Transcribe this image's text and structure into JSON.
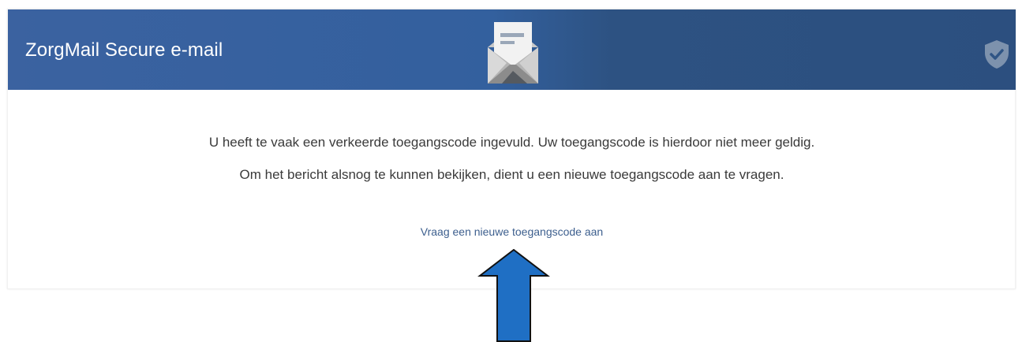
{
  "header": {
    "title": "ZorgMail Secure e-mail",
    "envelope_icon": "envelope-open-icon",
    "shield_icon": "shield-check-icon",
    "gradient_start": "#3b62a0",
    "gradient_end": "#2c4f7f"
  },
  "main": {
    "message_line_1": "U heeft te vaak een verkeerde toegangscode ingevuld. Uw toegangscode is hierdoor niet meer geldig.",
    "message_line_2": "Om het bericht alsnog te kunnen bekijken, dient u een nieuwe toegangscode aan te vragen.",
    "request_link": "Vraag een nieuwe toegangscode aan",
    "link_color": "#3d5f8e"
  },
  "annotation": {
    "arrow_icon": "arrow-up-icon",
    "arrow_color": "#1f6fc4"
  }
}
